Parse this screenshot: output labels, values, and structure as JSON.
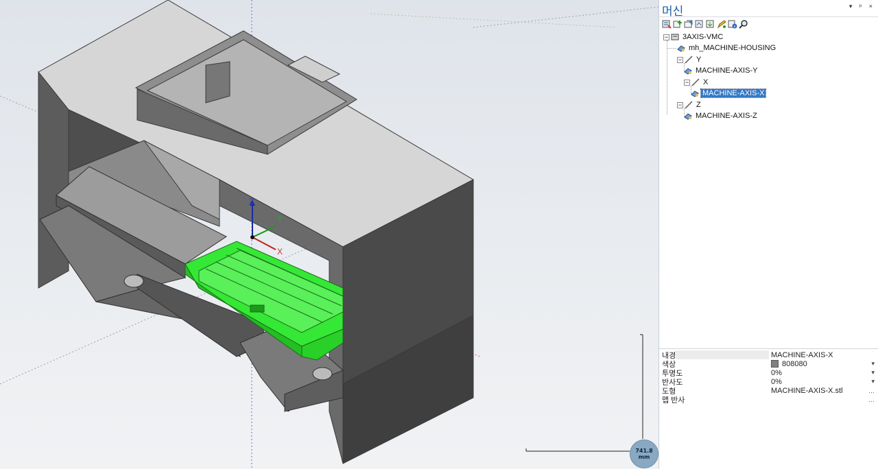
{
  "panel": {
    "title": "머신",
    "controls": "▾ ᵖ ×"
  },
  "toolbar": {
    "buttons": [
      "add-machine-icon",
      "add-component-icon",
      "add-axis-icon",
      "add-stl-icon",
      "import-icon",
      "edit-icon",
      "info-icon",
      "search-icon"
    ]
  },
  "tree": {
    "root": "3AXIS-VMC",
    "housing": "mh_MACHINE-HOUSING",
    "axis_y_group": "Y",
    "axis_y_item": "MACHINE-AXIS-Y",
    "axis_x_group": "X",
    "axis_x_item": "MACHINE-AXIS-X",
    "axis_z_group": "Z",
    "axis_z_item": "MACHINE-AXIS-Z",
    "expander_symbol": "−"
  },
  "properties": {
    "name_key": "내경",
    "name_val": "MACHINE-AXIS-X",
    "color_key": "색상",
    "color_val": "808080",
    "color_hex": "#808080",
    "transparency_key": "투명도",
    "transparency_val": "0%",
    "reflection_key": "반사도",
    "reflection_val": "0%",
    "shape_key": "도형",
    "shape_val": "MACHINE-AXIS-X.stl",
    "map_key": "맵 반사"
  },
  "viewport": {
    "scale_value": "741.8",
    "scale_unit": "mm",
    "axis_z": "Z",
    "axis_y": "Y",
    "axis_x": "X"
  },
  "colors": {
    "accent": "#3378c6",
    "highlight_part": "#35e835",
    "machine_gray": "#808080"
  }
}
